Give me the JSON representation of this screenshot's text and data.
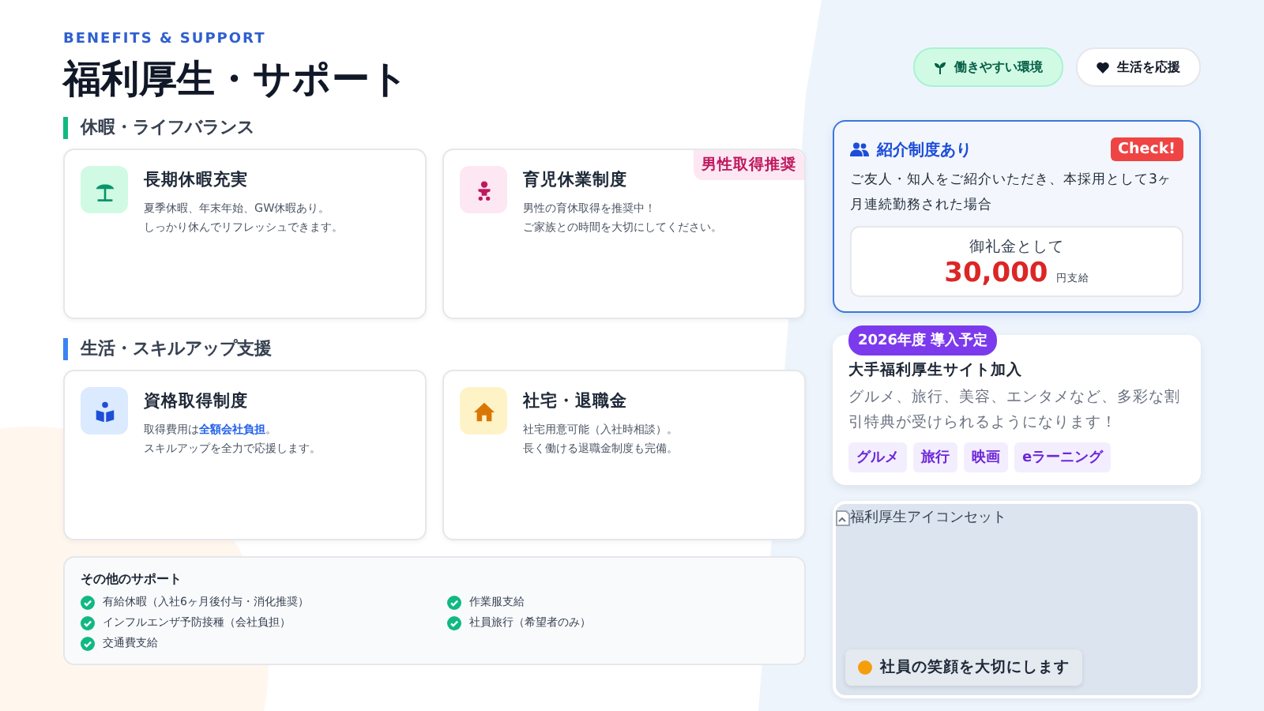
{
  "header": {
    "eyebrow": "BENEFITS & SUPPORT",
    "title": "福利厚生・サポート"
  },
  "tags": [
    {
      "label": "働きやすい環境",
      "kind": "sprout",
      "selected": true
    },
    {
      "label": "生活を応援",
      "kind": "heart",
      "selected": false
    }
  ],
  "sections": [
    {
      "heading": "休暇・ライフバランス",
      "color": "#10b981",
      "cards": [
        {
          "kind": "beach",
          "title": "長期休暇充実",
          "lines": [
            "夏季休暇、年末年始、GW休暇あり。",
            "しっかり休んでリフレッシュできます。"
          ]
        },
        {
          "kind": "baby",
          "title": "育児休業制度",
          "lines": [
            "男性の育休取得を推奨中！",
            "ご家族との時間を大切にしてください。"
          ],
          "badge": "男性取得推奨"
        }
      ]
    },
    {
      "heading": "生活・スキルアップ支援",
      "color": "#3b82f6",
      "cards": [
        {
          "kind": "book",
          "title": "資格取得制度",
          "lines": [
            "取得費用は**全額会社負担**。",
            "スキルアップを全力で応援します。"
          ]
        },
        {
          "kind": "house",
          "title": "社宅・退職金",
          "lines": [
            "社宅用意可能（入社時相談）。",
            "長く働ける退職金制度も完備。"
          ]
        }
      ]
    }
  ],
  "other_support": {
    "title": "その他のサポート",
    "items": [
      "有給休暇（入社6ヶ月後付与・消化推奨）",
      "作業服支給",
      "インフルエンザ予防接種（会社負担）",
      "社員旅行（希望者のみ）",
      "交通費支給"
    ]
  },
  "referral": {
    "title": "紹介制度あり",
    "badge": "Check!",
    "text": "ご友人・知人をご紹介いただき、本採用として3ヶ月連続勤務された場合",
    "reward_label": "御礼金として",
    "amount": "30,000",
    "unit": "円支給"
  },
  "plan": {
    "badge": "2026年度 導入予定",
    "title": "大手福利厚生サイト加入",
    "text": "グルメ、旅行、美容、エンタメなど、多彩な割引特典が受けられるようになります！",
    "tags": [
      "グルメ",
      "旅行",
      "映画",
      "eラーニング"
    ]
  },
  "image_card": {
    "alt": "福利厚生アイコンセット",
    "caption": "社員の笑顔を大切にします"
  }
}
